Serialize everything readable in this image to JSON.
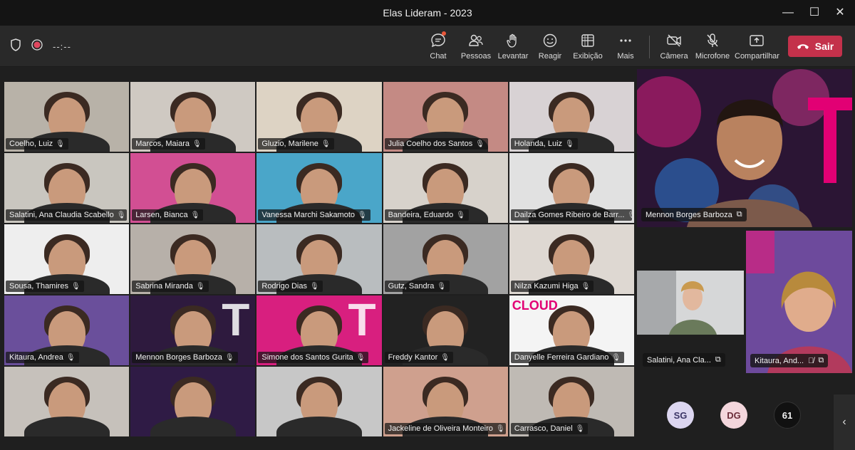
{
  "window": {
    "title": "Elas Lideram - 2023",
    "minimize": "—",
    "maximize": "☐",
    "close": "✕"
  },
  "toolbar": {
    "timer": "--:--",
    "buttons": [
      {
        "label": "Chat",
        "icon": "chat-icon"
      },
      {
        "label": "Pessoas",
        "icon": "people-icon"
      },
      {
        "label": "Levantar",
        "icon": "raise-hand-icon"
      },
      {
        "label": "Reagir",
        "icon": "smile-icon"
      },
      {
        "label": "Exibição",
        "icon": "grid-view-icon"
      },
      {
        "label": "Mais",
        "icon": "more-icon"
      },
      {
        "label": "Câmera",
        "icon": "camera-off-icon"
      },
      {
        "label": "Microfone",
        "icon": "mic-off-icon"
      },
      {
        "label": "Compartilhar",
        "icon": "share-icon"
      }
    ],
    "leave_label": "Sair",
    "leave_color": "#c4314b"
  },
  "grid": {
    "participants": [
      {
        "name": "Coelho, Luiz",
        "bg": "#b8b2a8"
      },
      {
        "name": "Marcos, Maiara",
        "bg": "#cfc9c2"
      },
      {
        "name": "Gluzio, Marilene",
        "bg": "#ddd3c4"
      },
      {
        "name": "Julia Coelho dos Santos",
        "bg": "#c48a84"
      },
      {
        "name": "Holanda, Luiz",
        "bg": "#d8d2d4"
      },
      {
        "name": "Salatini, Ana Claudia Scabello",
        "bg": "#c9c6bf"
      },
      {
        "name": "Larsen, Bianca",
        "bg": "#d24f93"
      },
      {
        "name": "Vanessa Marchi Sakamoto",
        "bg": "#4aa6c9"
      },
      {
        "name": "Bandeira, Eduardo",
        "bg": "#d7d2cb"
      },
      {
        "name": "Dailza Gomes Ribeiro de Barr...",
        "bg": "#e1e1e1"
      },
      {
        "name": "Sousa, Thamires",
        "bg": "#eeeeee"
      },
      {
        "name": "Sabrina Miranda",
        "bg": "#b7b0a9"
      },
      {
        "name": "Rodrigo Dias",
        "bg": "#b9bdbf"
      },
      {
        "name": "Gutz, Sandra",
        "bg": "#a2a2a2"
      },
      {
        "name": "Nilza Kazumi Higa",
        "bg": "#ded8d2"
      },
      {
        "name": "Kitaura, Andrea",
        "bg": "#6a4f9b"
      },
      {
        "name": "Mennon Borges Barboza",
        "bg": "#2e1a3e"
      },
      {
        "name": "Simone dos Santos Gurita",
        "bg": "#d81f7f"
      },
      {
        "name": "Freddy Kantor",
        "bg": "#222222"
      },
      {
        "name": "Danyelle Ferreira Gardiano",
        "bg": "#f4f4f4"
      },
      {
        "name": "",
        "bg": "#c6c1bb"
      },
      {
        "name": "",
        "bg": "#2f1b45"
      },
      {
        "name": "",
        "bg": "#c7c7c7"
      },
      {
        "name": "Jackeline de Oliveira Monteiro",
        "bg": "#cfa08e"
      },
      {
        "name": "Carrasco, Daniel",
        "bg": "#bfbab4"
      }
    ],
    "cloud_text": "CLOUD",
    "brand_letter": "T",
    "brand_color": "#e20074"
  },
  "side": {
    "big_name": "Mennon Borges Barboza",
    "mid1_name": "Salatini, Ana Cla...",
    "mid2_name": "Kitaura, And...",
    "avatars": [
      {
        "initials": "SG",
        "bg": "#dcd6f0",
        "fg": "#3b3566"
      },
      {
        "initials": "DG",
        "bg": "#f3d6dc",
        "fg": "#6b2d3a"
      },
      {
        "initials": "61",
        "bg": "#111111",
        "fg": "#f2f2f2"
      }
    ]
  }
}
